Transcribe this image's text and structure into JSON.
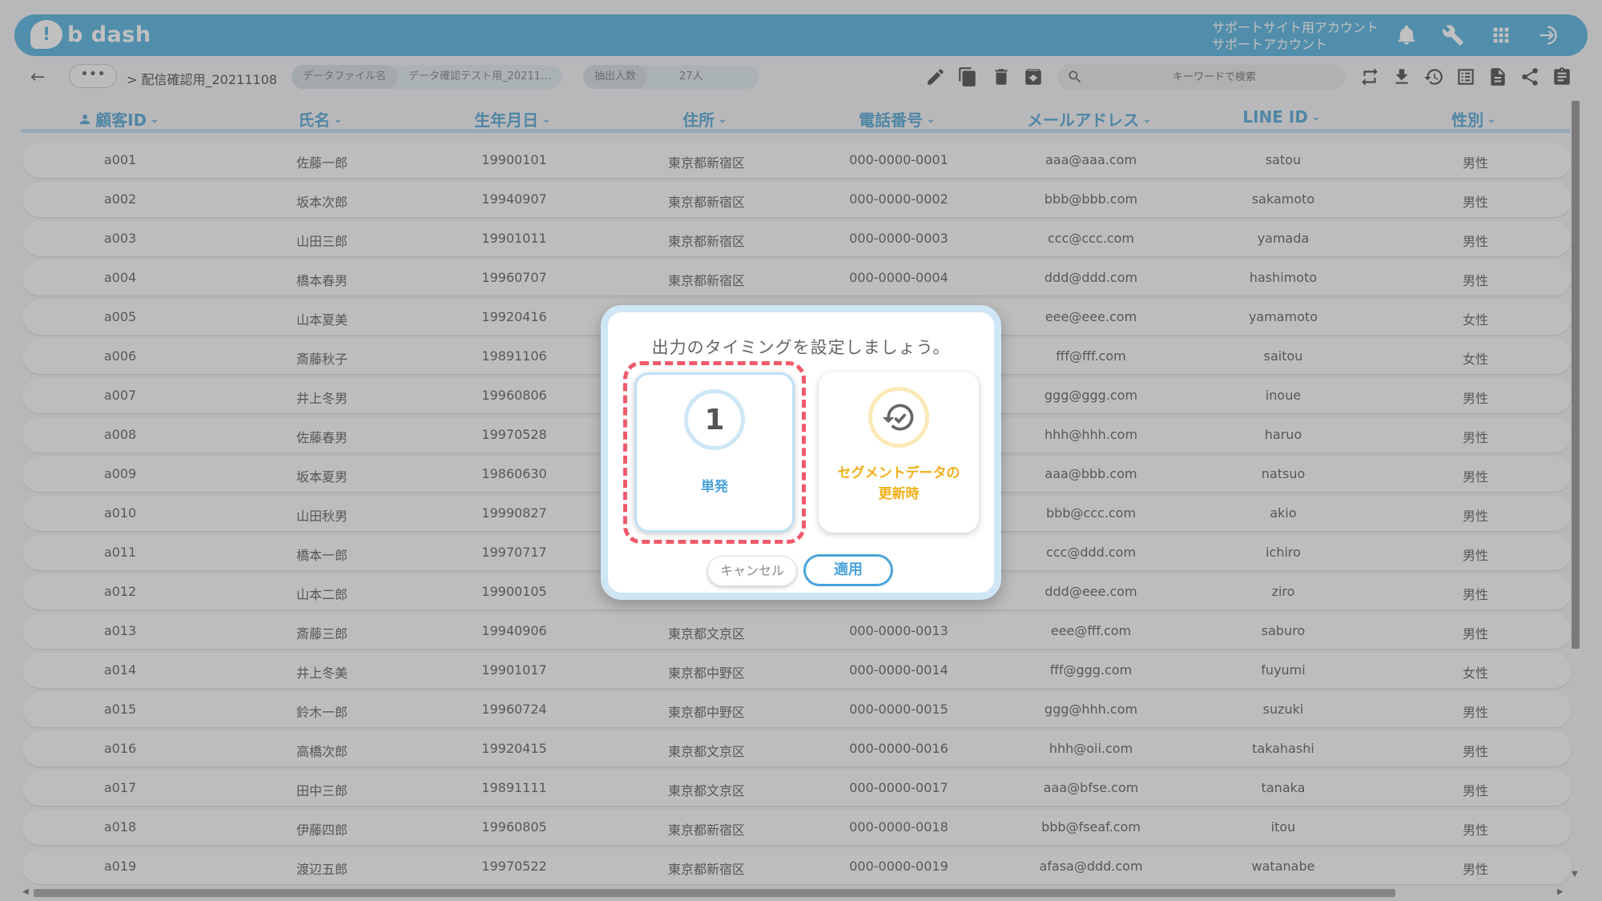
{
  "header": {
    "logo_text": "b dash",
    "account_line1": "サポートサイト用アカウント",
    "account_line2": "サポートアカウント",
    "icons": [
      "bell-icon",
      "wrench-icon",
      "apps-grid-icon",
      "logout-icon"
    ]
  },
  "toolbar": {
    "back_label": "←",
    "more_label": "•••",
    "breadcrumb": "> 配信確認用_20211108",
    "data_file_label": "データファイル名",
    "data_file_value": "データ確認テスト用_20211…",
    "extract_label": "抽出人数",
    "extract_value": "27人",
    "search_placeholder": "キーワードで検索"
  },
  "table": {
    "headers": [
      "顧客ID",
      "氏名",
      "生年月日",
      "住所",
      "電話番号",
      "メールアドレス",
      "LINE ID",
      "性別"
    ],
    "rows": [
      [
        "a001",
        "佐藤一郎",
        "19900101",
        "東京都新宿区",
        "000-0000-0001",
        "aaa@aaa.com",
        "satou",
        "男性"
      ],
      [
        "a002",
        "坂本次郎",
        "19940907",
        "東京都新宿区",
        "000-0000-0002",
        "bbb@bbb.com",
        "sakamoto",
        "男性"
      ],
      [
        "a003",
        "山田三郎",
        "19901011",
        "東京都新宿区",
        "000-0000-0003",
        "ccc@ccc.com",
        "yamada",
        "男性"
      ],
      [
        "a004",
        "橋本春男",
        "19960707",
        "東京都新宿区",
        "000-0000-0004",
        "ddd@ddd.com",
        "hashimoto",
        "男性"
      ],
      [
        "a005",
        "山本夏美",
        "19920416",
        "",
        "",
        "eee@eee.com",
        "yamamoto",
        "女性"
      ],
      [
        "a006",
        "斎藤秋子",
        "19891106",
        "",
        "",
        "fff@fff.com",
        "saitou",
        "女性"
      ],
      [
        "a007",
        "井上冬男",
        "19960806",
        "",
        "",
        "ggg@ggg.com",
        "inoue",
        "男性"
      ],
      [
        "a008",
        "佐藤春男",
        "19970528",
        "",
        "",
        "hhh@hhh.com",
        "haruo",
        "男性"
      ],
      [
        "a009",
        "坂本夏男",
        "19860630",
        "",
        "",
        "aaa@bbb.com",
        "natsuo",
        "男性"
      ],
      [
        "a010",
        "山田秋男",
        "19990827",
        "",
        "",
        "bbb@ccc.com",
        "akio",
        "男性"
      ],
      [
        "a011",
        "橋本一郎",
        "19970717",
        "",
        "",
        "ccc@ddd.com",
        "ichiro",
        "男性"
      ],
      [
        "a012",
        "山本二郎",
        "19900105",
        "",
        "",
        "ddd@eee.com",
        "ziro",
        "男性"
      ],
      [
        "a013",
        "斎藤三郎",
        "19940906",
        "東京都文京区",
        "000-0000-0013",
        "eee@fff.com",
        "saburo",
        "男性"
      ],
      [
        "a014",
        "井上冬美",
        "19901017",
        "東京都中野区",
        "000-0000-0014",
        "fff@ggg.com",
        "fuyumi",
        "女性"
      ],
      [
        "a015",
        "鈴木一郎",
        "19960724",
        "東京都中野区",
        "000-0000-0015",
        "ggg@hhh.com",
        "suzuki",
        "男性"
      ],
      [
        "a016",
        "高橋次郎",
        "19920415",
        "東京都文京区",
        "000-0000-0016",
        "hhh@oii.com",
        "takahashi",
        "男性"
      ],
      [
        "a017",
        "田中三郎",
        "19891111",
        "東京都文京区",
        "000-0000-0017",
        "aaa@bfse.com",
        "tanaka",
        "男性"
      ],
      [
        "a018",
        "伊藤四郎",
        "19960805",
        "東京都新宿区",
        "000-0000-0018",
        "bbb@fseaf.com",
        "itou",
        "男性"
      ],
      [
        "a019",
        "渡辺五郎",
        "19970522",
        "東京都新宿区",
        "000-0000-0019",
        "afasa@ddd.com",
        "watanabe",
        "男性"
      ]
    ]
  },
  "modal": {
    "title": "出力のタイミングを設定しましょう。",
    "option1_number": "1",
    "option1_label": "単発",
    "option2_label_line1": "セグメントデータの",
    "option2_label_line2": "更新時",
    "cancel_label": "キャンセル",
    "apply_label": "適用"
  },
  "colors": {
    "brand": "#5cb6e0",
    "accent_blue": "#4aa3db",
    "accent_yellow": "#f0b019",
    "highlight_red": "#f05a6a"
  }
}
